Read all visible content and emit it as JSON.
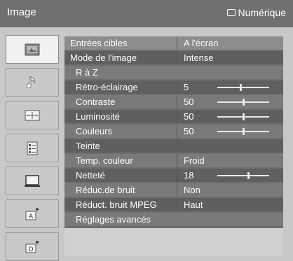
{
  "header": {
    "title": "Image",
    "source_label": "Numérique",
    "source_icon": "tv-icon"
  },
  "sidebar": {
    "items": [
      {
        "name": "picture",
        "icon": "picture-icon",
        "selected": true
      },
      {
        "name": "sound",
        "icon": "music-note-icon",
        "selected": false
      },
      {
        "name": "screen",
        "icon": "screen-format-icon",
        "selected": false
      },
      {
        "name": "features",
        "icon": "list-icon",
        "selected": false
      },
      {
        "name": "pc",
        "icon": "monitor-icon",
        "selected": false
      },
      {
        "name": "analog-setup",
        "icon": "analog-antenna-icon",
        "selected": false
      },
      {
        "name": "digital-setup",
        "icon": "digital-antenna-icon",
        "selected": false
      }
    ]
  },
  "menu": {
    "rows": [
      {
        "label": "Entrées cibles",
        "value": "A l'écran"
      },
      {
        "label": "Mode de l'image",
        "value": "Intense"
      },
      {
        "label": "R à Z",
        "value": ""
      },
      {
        "label": "Rétro-éclairage",
        "value": "5",
        "slider": 0.45
      },
      {
        "label": "Contraste",
        "value": "50",
        "slider": 0.5
      },
      {
        "label": "Luminosité",
        "value": "50",
        "slider": 0.5
      },
      {
        "label": "Couleurs",
        "value": "50",
        "slider": 0.5
      },
      {
        "label": "Teinte",
        "value": ""
      },
      {
        "label": "Temp. couleur",
        "value": "Froid"
      },
      {
        "label": "Netteté",
        "value": "18",
        "slider": 0.6
      },
      {
        "label": "Réduc.de bruit",
        "value": "Non"
      },
      {
        "label": "Réduct. bruit MPEG",
        "value": "Haut"
      },
      {
        "label": "Réglages avancés",
        "value": ""
      }
    ]
  },
  "colors": {
    "titlebar": "#707070",
    "panel": "#c8c8c8",
    "menu": "#6e6e6e"
  }
}
